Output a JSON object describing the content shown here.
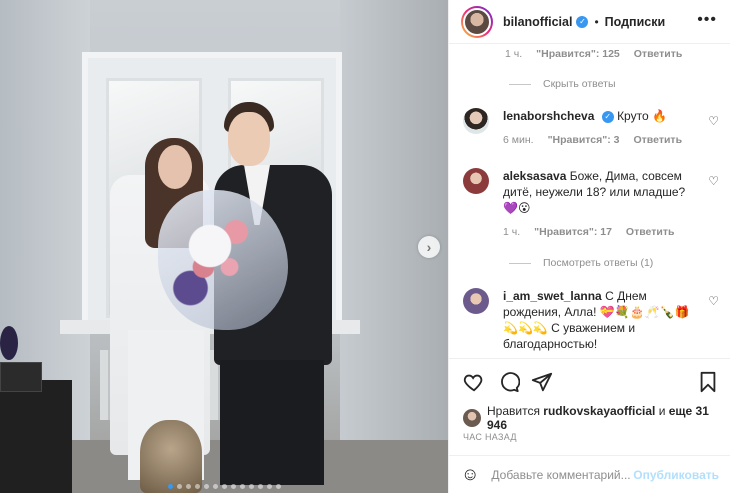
{
  "post_image": {
    "has_next_button": true,
    "carousel_dots": 13,
    "active_dot": 0
  },
  "header": {
    "username": "bilanofficial",
    "separator": "•",
    "follow_label": "Подписки",
    "more_label": "•••"
  },
  "top_meta": {
    "time": "1 ч.",
    "likes": "\"Нравится\": 125",
    "reply": "Ответить"
  },
  "hide_replies": "Скрыть ответы",
  "comments": [
    {
      "user": "lenaborshcheva",
      "verified": true,
      "text": "Круто 🔥",
      "time": "6 мин.",
      "likes": "\"Нравится\": 3",
      "reply": "Ответить",
      "avatar_color": "#c8a79a"
    },
    {
      "user": "aleksasava",
      "verified": false,
      "text": "Боже, Дима, совсем дитё, неужели 18? или младше? 💜😮",
      "time": "1 ч.",
      "likes": "\"Нравится\": 17",
      "reply": "Ответить",
      "avatar_color": "#8b3b3b"
    },
    {
      "user": "i_am_swet_lanna",
      "verified": false,
      "text": "С Днем рождения, Алла! 💝💐🎂🥂🍾🎁💫💫💫 С уважением и благодарностью!",
      "avatar_color": "#8a6db0"
    }
  ],
  "show_replies": "Посмотреть ответы (1)",
  "likes_summary": {
    "prefix": "Нравится",
    "user": "rudkovskayaofficial",
    "suffix": "и",
    "count": "еще 31 946"
  },
  "time_ago": "ЧАС НАЗАД",
  "comment_input": {
    "placeholder": "Добавьте комментарий...",
    "publish_label": "Опубликовать"
  },
  "colors": {
    "accent": "#3897f0",
    "muted": "#8e8e8e",
    "publish_disabled": "#b2dffc"
  }
}
